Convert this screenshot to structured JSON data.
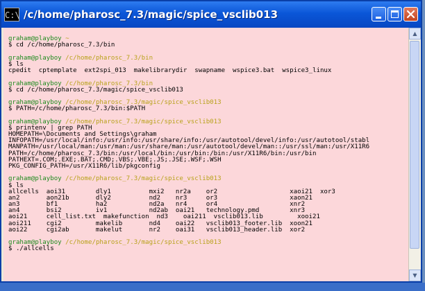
{
  "window": {
    "title": "/c/home/pharosc_7.3/magic/spice_vsclib013",
    "icon_text": "C:\\",
    "controls": [
      "minimize",
      "maximize",
      "close"
    ]
  },
  "terminal": {
    "colors": {
      "background": "#fcd7da",
      "user": "#1e8b1e",
      "path": "#b8a21a",
      "text": "#000000"
    },
    "lines": [
      {
        "u": "",
        "p": "",
        "t": ""
      },
      {
        "u": "graham@playboy",
        "p": "~",
        "t": ""
      },
      {
        "u": "",
        "p": "",
        "t": "$ cd /c/home/pharosc_7.3/bin"
      },
      {
        "u": "",
        "p": "",
        "t": ""
      },
      {
        "u": "graham@playboy",
        "p": "/c/home/pharosc_7.3/bin",
        "t": ""
      },
      {
        "u": "",
        "p": "",
        "t": "$ ls"
      },
      {
        "u": "",
        "p": "",
        "t": "cpedit  cptemplate  ext2spi_013  makelibrarydir  swapname  wspice3.bat  wspice3_linux"
      },
      {
        "u": "",
        "p": "",
        "t": ""
      },
      {
        "u": "graham@playboy",
        "p": "/c/home/pharosc_7.3/bin",
        "t": ""
      },
      {
        "u": "",
        "p": "",
        "t": "$ cd /c/home/pharosc_7.3/magic/spice_vsclib013"
      },
      {
        "u": "",
        "p": "",
        "t": ""
      },
      {
        "u": "graham@playboy",
        "p": "/c/home/pharosc_7.3/magic/spice_vsclib013",
        "t": ""
      },
      {
        "u": "",
        "p": "",
        "t": "$ PATH=/c/home/pharosc_7.3/bin:$PATH"
      },
      {
        "u": "",
        "p": "",
        "t": ""
      },
      {
        "u": "graham@playboy",
        "p": "/c/home/pharosc_7.3/magic/spice_vsclib013",
        "t": ""
      },
      {
        "u": "",
        "p": "",
        "t": "$ printenv | grep PATH"
      },
      {
        "u": "",
        "p": "",
        "t": "HOMEPATH=\\Documents and Settings\\graham"
      },
      {
        "u": "",
        "p": "",
        "t": "INFOPATH=/usr/local/info:/usr/info:/usr/share/info:/usr/autotool/devel/info:/usr/autotool/stabl"
      },
      {
        "u": "",
        "p": "",
        "t": "MANPATH=/usr/local/man:/usr/man:/usr/share/man:/usr/autotool/devel/man::/usr/ssl/man:/usr/X11R6"
      },
      {
        "u": "",
        "p": "",
        "t": "PATH=/c/home/pharosc_7.3/bin:/usr/local/bin:/usr/bin:/bin:/usr/X11R6/bin:/usr/bin"
      },
      {
        "u": "",
        "p": "",
        "t": "PATHEXT=.COM;.EXE;.BAT;.CMD;.VBS;.VBE;.JS;.JSE;.WSF;.WSH"
      },
      {
        "u": "",
        "p": "",
        "t": "PKG_CONFIG_PATH=/usr/X11R6/lib/pkgconfig"
      },
      {
        "u": "",
        "p": "",
        "t": ""
      },
      {
        "u": "graham@playboy",
        "p": "/c/home/pharosc_7.3/magic/spice_vsclib013",
        "t": ""
      },
      {
        "u": "",
        "p": "",
        "t": "$ ls"
      },
      {
        "u": "",
        "p": "",
        "t": "allcells  aoi31        dly1          mxi2   nr2a    or2                   xaoi21  xor3"
      },
      {
        "u": "",
        "p": "",
        "t": "an2       aon21b       dly2          nd2    nr3     or3                   xaon21"
      },
      {
        "u": "",
        "p": "",
        "t": "an3       bf1          ha2           nd2a   nr4     or4                   xnr2"
      },
      {
        "u": "",
        "p": "",
        "t": "an4       bsi2         iv1           nd2ab  oai21   technology.pmd        xnr3"
      },
      {
        "u": "",
        "p": "",
        "t": "aoi21     cell_list.txt  makefunction  nd3    oai211  vsclib013.lib         xooi21"
      },
      {
        "u": "",
        "p": "",
        "t": "aoi211    cgi2         makelib       nd4    oai22   vsclib013_footer.lib  xoon21"
      },
      {
        "u": "",
        "p": "",
        "t": "aoi22     cgi2ab       makelut       nr2    oai31   vsclib013_header.lib  xor2"
      },
      {
        "u": "",
        "p": "",
        "t": ""
      },
      {
        "u": "graham@playboy",
        "p": "/c/home/pharosc_7.3/magic/spice_vsclib013",
        "t": ""
      },
      {
        "u": "",
        "p": "",
        "t": "$ ./allcells"
      }
    ]
  }
}
